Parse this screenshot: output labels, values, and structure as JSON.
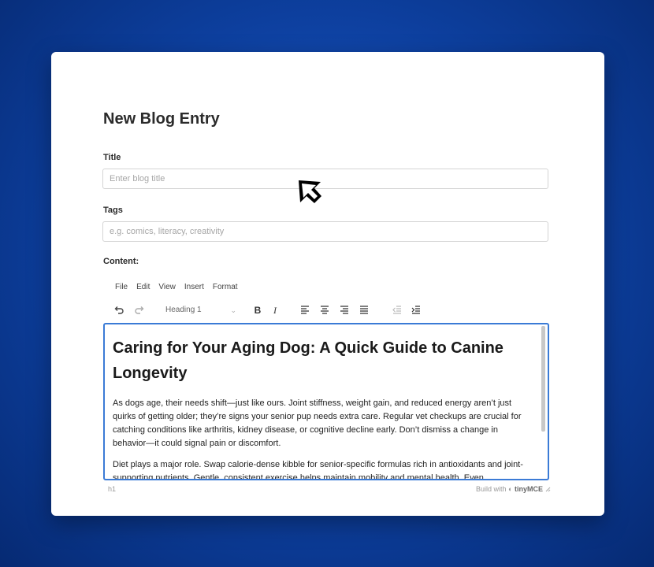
{
  "form": {
    "heading": "New Blog Entry",
    "title_label": "Title",
    "title_placeholder": "Enter blog title",
    "title_value": "",
    "tags_label": "Tags",
    "tags_placeholder": "e.g. comics, literacy, creativity",
    "tags_value": "",
    "content_label": "Content:"
  },
  "editor": {
    "menu": [
      "File",
      "Edit",
      "View",
      "Insert",
      "Format"
    ],
    "block_format": "Heading 1",
    "toolbar_icons": [
      "undo-icon",
      "redo-icon",
      "bold-icon",
      "italic-icon",
      "align-left-icon",
      "align-center-icon",
      "align-right-icon",
      "align-justify-icon",
      "outdent-icon",
      "indent-icon"
    ],
    "bold_glyph": "B",
    "italic_glyph": "I",
    "heading": "Caring for Your Aging Dog: A Quick Guide to Canine Longevity",
    "paragraphs": [
      "As dogs age, their needs shift—just like ours. Joint stiffness, weight gain, and reduced energy aren’t just quirks of getting older; they’re signs your senior pup needs extra care. Regular vet checkups are crucial for catching conditions like arthritis, kidney disease, or cognitive decline early. Don’t dismiss a change in behavior—it could signal pain or discomfort.",
      "Diet plays a major role. Swap calorie-dense kibble for senior-specific formulas rich in antioxidants and joint-supporting nutrients. Gentle, consistent exercise helps maintain mobility and mental health. Even"
    ],
    "status_path": "h1",
    "branding_prefix": "Build with",
    "branding_name": "tinyMCE"
  },
  "colors": {
    "background": "#0d3f9e",
    "card": "#ffffff",
    "editor_focus_border": "#3b7bd6"
  }
}
